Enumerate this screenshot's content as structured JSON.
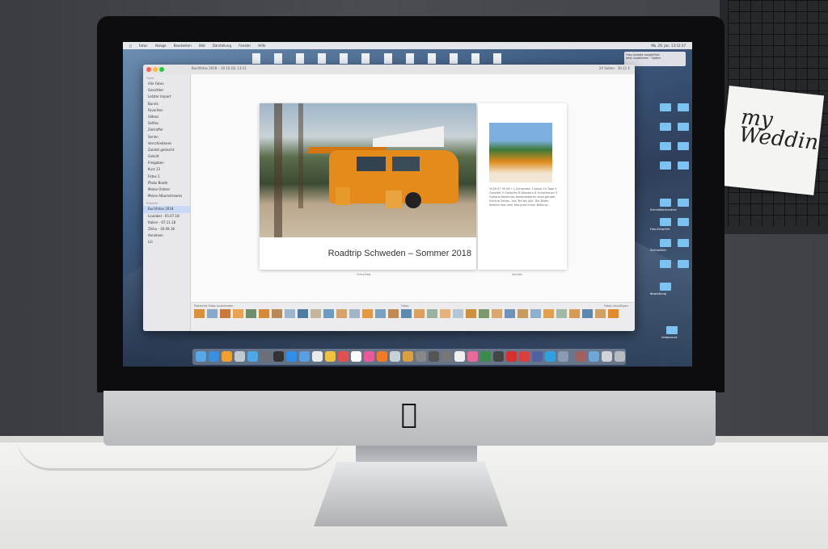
{
  "menubar": {
    "items": [
      "Fotos",
      "Ablage",
      "Bearbeiten",
      "Bild",
      "Darstellung",
      "Fenster",
      "Hilfe"
    ],
    "right": "Mo. 29. Jan. 13:12:37"
  },
  "window": {
    "title": "Buchfotos 2018 – 10.10.18, 13:11",
    "controls": "24 Seiten · 30,11 €"
  },
  "sidebar": {
    "headers": [
      "Fotos",
      "Projekte"
    ],
    "items": [
      "Alle Fotos",
      "Gesichter",
      "Letzter Import",
      "Bursts",
      "Favoriten",
      "Videos",
      "Selfies",
      "Zeitraffer",
      "Serien",
      "Verschiedenes",
      "Zuletzt gelöscht",
      "Geteilt",
      "Freigaben",
      "Kurz 13",
      "Fotos 1",
      "Photo Booth",
      "Meine Ordner",
      "Meine Albumstreams",
      "Buchfotos 2018",
      "Loulabel - 05.07.18",
      "Italien - 07.11.18",
      "Zhiku - 30.09.18",
      "Anneleen",
      "Lili"
    ]
  },
  "book": {
    "caption": "Roadtrip Schweden – Sommer 2018",
    "right_text": "2018 07 09 08 • 1 Schweden 3 Kanal 10 Tage 4 Gezeltet 5 Gelaufen 6 Wandern 8 Schwimmen 9 Gotland Kostenlos bewerbebaren etwa gerade. Schöne Zeiten. Von Teil bis Alle. Die Bilder wirkten fast sehr fast gute ihrem Bildung...",
    "left_label": "Umschlag",
    "right_label": "Vorsatz"
  },
  "filmstrip": {
    "label_left": "Platzierte Fotos ausblenden",
    "label_center": "Fotos",
    "label_right": "Fotos hinzufügen"
  },
  "notification": {
    "title": "Foto-Update ausgeführt",
    "body": "Jetzt installieren · Später"
  },
  "desktop": {
    "folders": [
      "Schreibtischordner",
      "Foto-Entwürfe",
      "Stichwörter",
      "Bewerbung",
      "Unbenannt"
    ]
  },
  "room": {
    "note_text": "my Wedding"
  }
}
